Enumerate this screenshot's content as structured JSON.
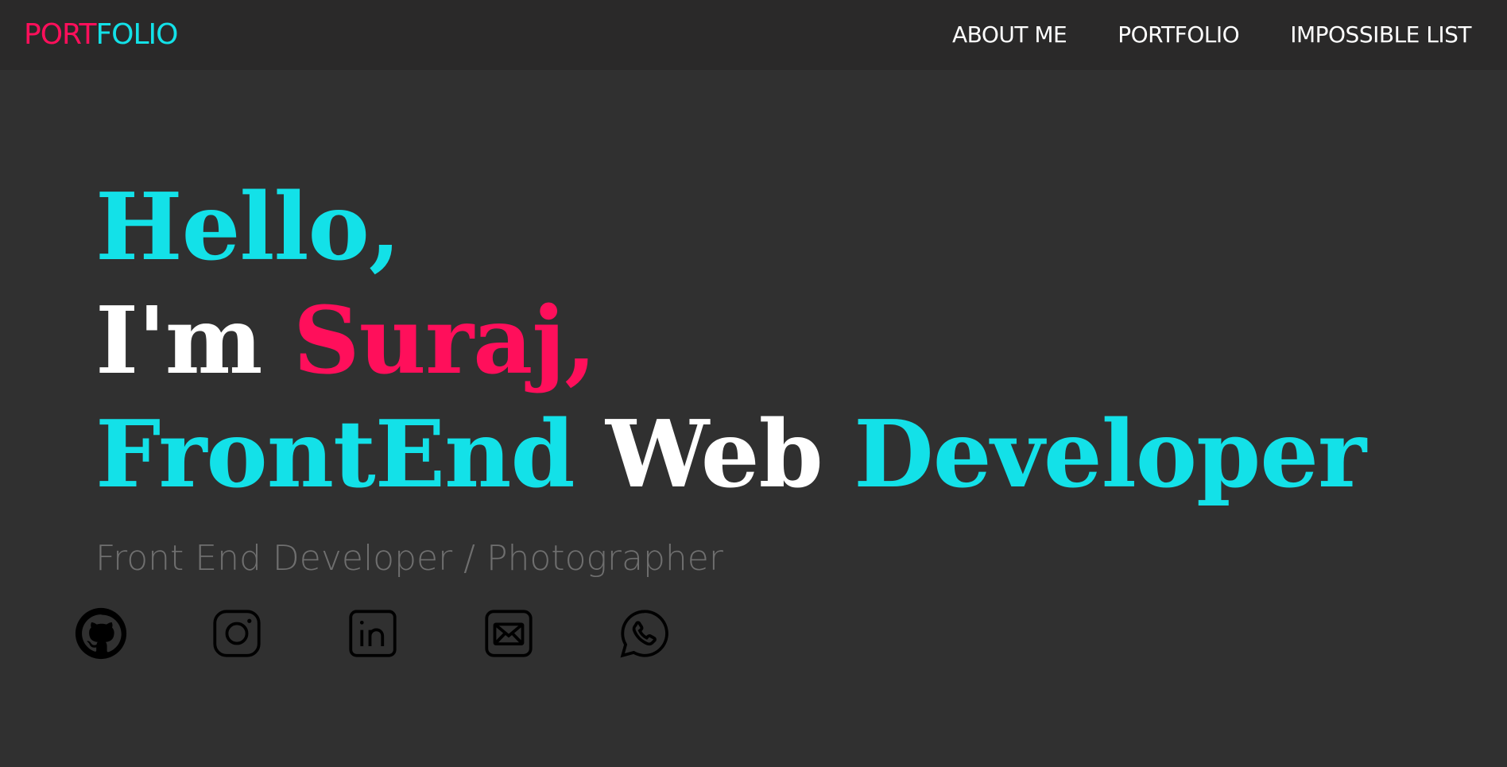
{
  "logo": {
    "part1": "PORT",
    "part2": "FOLIO"
  },
  "nav": {
    "items": [
      {
        "label": "ABOUT ME"
      },
      {
        "label": "PORTFOLIO"
      },
      {
        "label": "IMPOSSIBLE LIST"
      }
    ]
  },
  "hero": {
    "line1": "Hello,",
    "line2_prefix": "I'm ",
    "line2_name": "Suraj,",
    "line3_a": "FrontEnd ",
    "line3_b": "Web ",
    "line3_c": "Developer"
  },
  "subtitle": "Front End Developer / Photographer",
  "socials": [
    {
      "icon": "github-icon"
    },
    {
      "icon": "instagram-icon"
    },
    {
      "icon": "linkedin-icon"
    },
    {
      "icon": "mail-icon"
    },
    {
      "icon": "whatsapp-icon"
    }
  ],
  "colors": {
    "accent_pink": "#ff0f5b",
    "accent_cyan": "#13e1e8",
    "background": "#303030",
    "navbar": "#2a2929"
  }
}
